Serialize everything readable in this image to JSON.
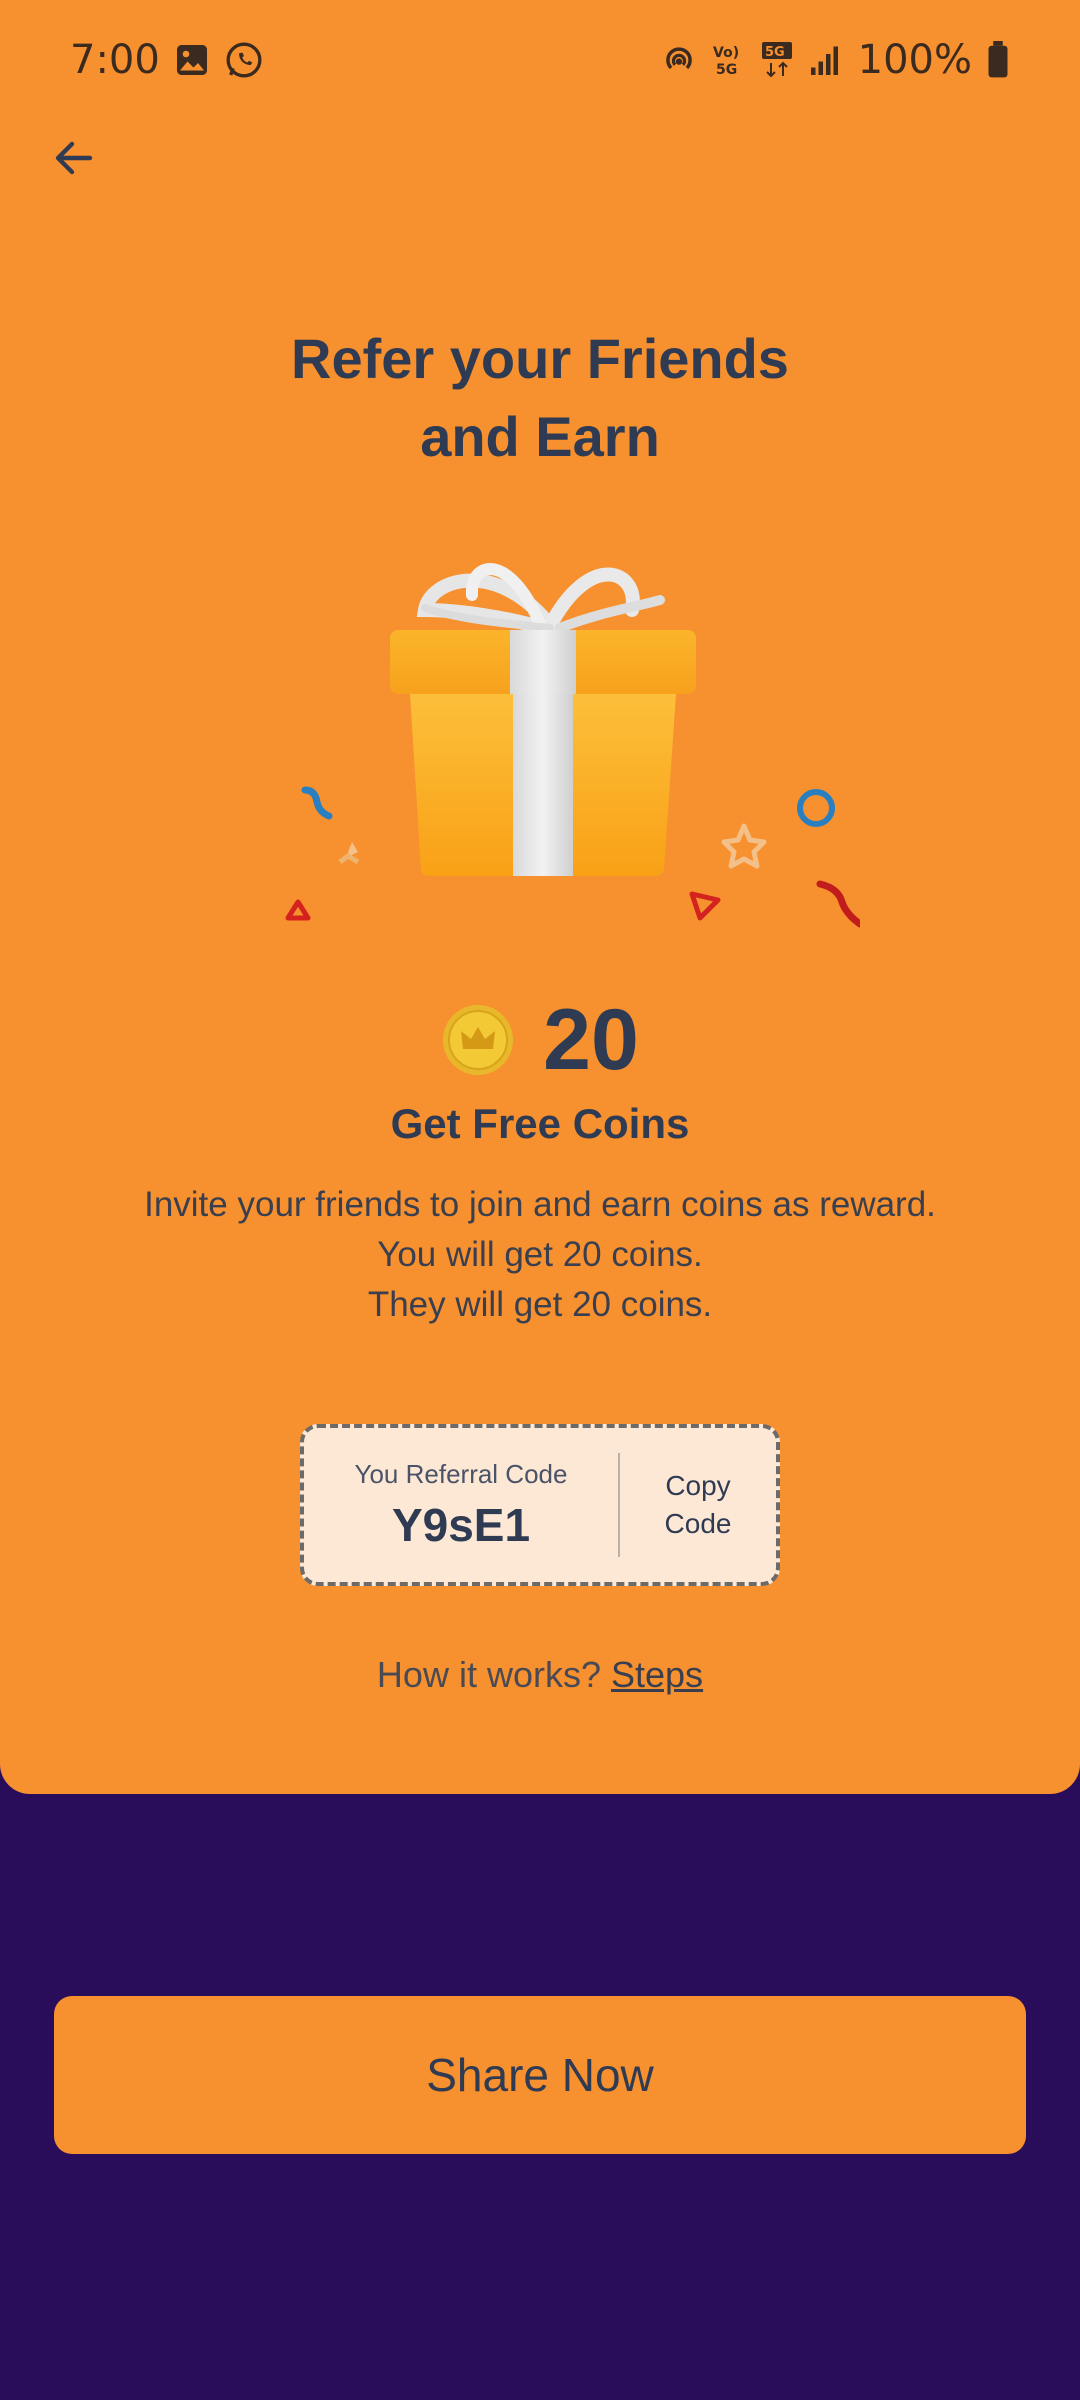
{
  "status_bar": {
    "time": "7:00",
    "battery": "100%",
    "icons": [
      "gallery-icon",
      "whatsapp-icon",
      "hotspot-icon",
      "volte-5g-icon",
      "5g-data-icon",
      "signal-icon",
      "battery-icon"
    ]
  },
  "header": {
    "back_icon": "arrow-left-icon"
  },
  "hero": {
    "title_line1": "Refer your Friends",
    "title_line2": "and Earn",
    "illustration": "gift-box-icon"
  },
  "reward": {
    "coin_icon": "crown-coin-icon",
    "coins": "20",
    "subtitle": "Get Free Coins",
    "desc_line1": "Invite your friends to join and earn coins as reward.",
    "desc_line2": "You will get 20 coins.",
    "desc_line3": "They will get 20 coins."
  },
  "referral": {
    "label": "You Referral Code",
    "code": "Y9sE1",
    "copy_line1": "Copy",
    "copy_line2": "Code"
  },
  "help": {
    "prefix": "How it works?",
    "link": "Steps"
  },
  "actions": {
    "share_label": "Share Now"
  },
  "colors": {
    "primary": "#f7902e",
    "background": "#2a0d5a",
    "text": "#2f3b52",
    "code_box": "#fde8d6"
  }
}
